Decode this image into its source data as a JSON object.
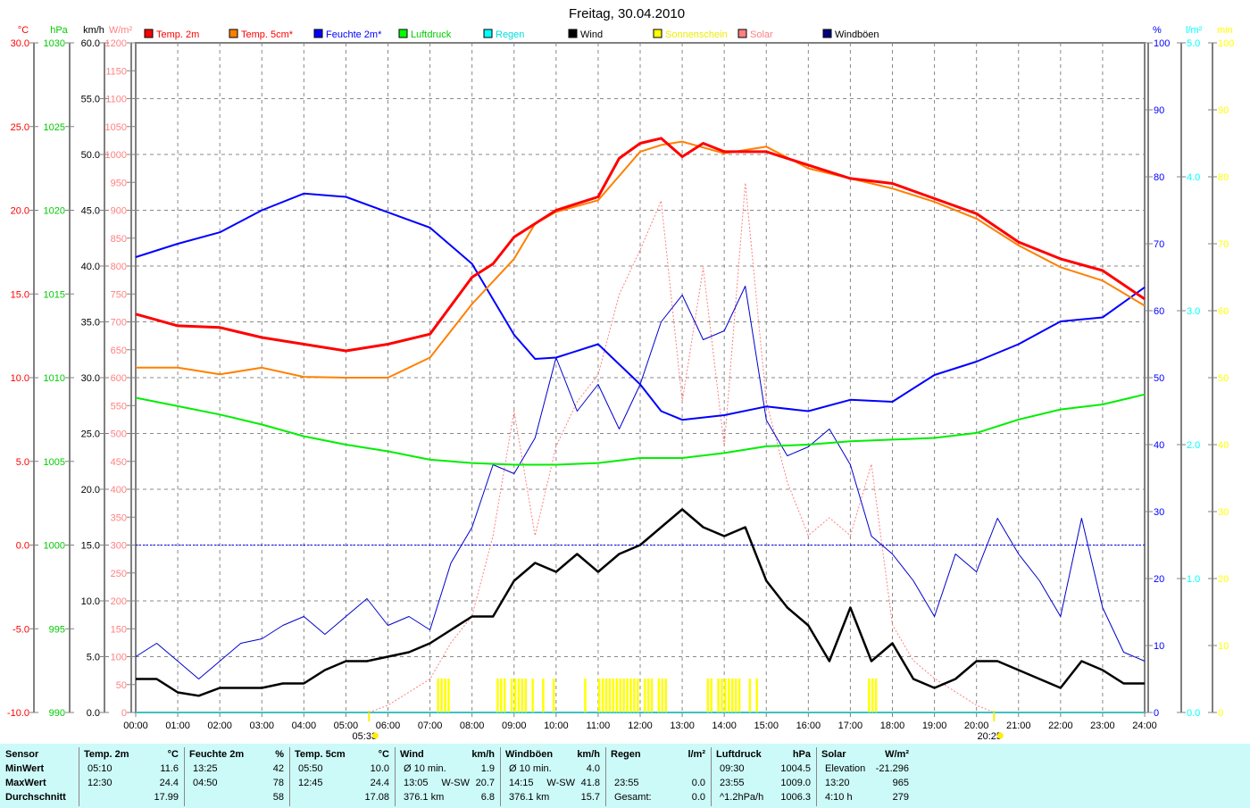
{
  "title": "Freitag, 30.04.2010",
  "colors": {
    "temp2m": "#ff0000",
    "temp5cm": "#ff8000",
    "humidity": "#0000ff",
    "pressure": "#00ee00",
    "rain": "#00ffff",
    "wind": "#000000",
    "sunshine": "#ffff00",
    "solar": "#ff8080",
    "gusts": "#000080"
  },
  "legend": [
    {
      "label": "Temp. 2m",
      "color": "#ff0000",
      "text": "#ff0000"
    },
    {
      "label": "Temp. 5cm*",
      "color": "#ff8000",
      "text": "#ff0000"
    },
    {
      "label": "Feuchte 2m*",
      "color": "#0000ff",
      "text": "#0000ff"
    },
    {
      "label": "Luftdruck",
      "color": "#00ff00",
      "text": "#00cc00"
    },
    {
      "label": "Regen",
      "color": "#00ffff",
      "text": "#00dddd"
    },
    {
      "label": "Wind",
      "color": "#000000",
      "text": "#000000"
    },
    {
      "label": "Sonnenschein",
      "color": "#ffff00",
      "text": "#eeee00"
    },
    {
      "label": "Solar",
      "color": "#ff8080",
      "text": "#ff8080"
    },
    {
      "label": "Windböen",
      "color": "#000080",
      "text": "#000000"
    }
  ],
  "chart_data": {
    "type": "line",
    "title": "Freitag, 30.04.2010",
    "x_unit": "hours",
    "xticks": [
      "00:00",
      "01:00",
      "02:00",
      "03:00",
      "04:00",
      "05:00",
      "06:00",
      "07:00",
      "08:00",
      "09:00",
      "10:00",
      "11:00",
      "12:00",
      "13:00",
      "14:00",
      "15:00",
      "16:00",
      "17:00",
      "18:00",
      "19:00",
      "20:00",
      "21:00",
      "22:00",
      "23:00",
      "24:00"
    ],
    "axes": {
      "celsius": {
        "unit": "°C",
        "range": [
          -10,
          30
        ],
        "ticks": [
          "30.0",
          "25.0",
          "20.0",
          "15.0",
          "10.0",
          "5.0",
          "0.0",
          "-5.0",
          "-10.0"
        ],
        "color": "#ff0000"
      },
      "hpa": {
        "unit": "hPa",
        "range": [
          990,
          1030
        ],
        "ticks": [
          "1030",
          "1025",
          "1020",
          "1015",
          "1010",
          "1005",
          "1000",
          "995",
          "990"
        ],
        "color": "#00cc00"
      },
      "kmh": {
        "unit": "km/h",
        "range": [
          0,
          60
        ],
        "ticks": [
          "60.0",
          "55.0",
          "50.0",
          "45.0",
          "40.0",
          "35.0",
          "30.0",
          "25.0",
          "20.0",
          "15.0",
          "10.0",
          "5.0",
          "0.0"
        ],
        "color": "#000000"
      },
      "wm2": {
        "unit": "W/m²",
        "range": [
          0,
          1200
        ],
        "ticks": [
          "1200",
          "1150",
          "1100",
          "1050",
          "1000",
          "950",
          "900",
          "850",
          "800",
          "750",
          "700",
          "650",
          "600",
          "550",
          "500",
          "450",
          "400",
          "350",
          "300",
          "250",
          "200",
          "150",
          "100",
          "50",
          "0"
        ],
        "color": "#ff8080"
      },
      "percent": {
        "unit": "%",
        "range": [
          0,
          100
        ],
        "ticks": [
          "100",
          "90",
          "80",
          "70",
          "60",
          "50",
          "40",
          "30",
          "20",
          "10",
          "0"
        ],
        "color": "#0000ff"
      },
      "lm2": {
        "unit": "l/m²",
        "range": [
          0,
          5
        ],
        "ticks": [
          "5.0",
          "4.0",
          "3.0",
          "2.0",
          "1.0",
          "0.0"
        ],
        "color": "#00ffff"
      },
      "min": {
        "unit": "min",
        "range": [
          0,
          100
        ],
        "ticks": [
          "100",
          "90",
          "80",
          "70",
          "60",
          "50",
          "40",
          "30",
          "20",
          "10",
          "0"
        ],
        "color": "#ffff00"
      }
    },
    "series": [
      {
        "name": "Temp. 2m",
        "axis": "celsius",
        "x": [
          0,
          1,
          2,
          3,
          4,
          5,
          6,
          7,
          8,
          8.5,
          9,
          10,
          11,
          11.5,
          12,
          12.5,
          13,
          13.5,
          14,
          15,
          16,
          17,
          18,
          19,
          20,
          21,
          22,
          23,
          24
        ],
        "values": [
          13.8,
          13.1,
          13.0,
          12.4,
          12.0,
          11.6,
          12.0,
          12.6,
          16.0,
          16.8,
          18.4,
          20.0,
          20.8,
          23.1,
          24.0,
          24.3,
          23.2,
          24.0,
          23.5,
          23.5,
          22.7,
          21.9,
          21.6,
          20.7,
          19.8,
          18.1,
          17.1,
          16.4,
          14.7
        ]
      },
      {
        "name": "Temp. 5cm*",
        "axis": "celsius",
        "x": [
          0,
          1,
          2,
          3,
          4,
          5,
          6,
          7,
          8,
          9,
          9.5,
          10,
          11,
          12,
          12.5,
          13,
          14,
          15,
          16,
          17,
          18,
          19,
          20,
          21,
          22,
          23,
          24
        ],
        "values": [
          10.6,
          10.6,
          10.2,
          10.6,
          10.05,
          10.0,
          10.0,
          11.2,
          14.4,
          17.1,
          19.2,
          19.9,
          20.6,
          23.5,
          23.9,
          24.1,
          23.4,
          23.8,
          22.5,
          21.9,
          21.3,
          20.5,
          19.5,
          17.9,
          16.6,
          15.8,
          14.3
        ]
      },
      {
        "name": "Feuchte 2m*",
        "axis": "percent",
        "x": [
          0,
          1,
          2,
          3,
          4,
          5,
          6,
          7,
          8,
          8.5,
          9,
          9.5,
          10,
          11,
          12,
          12.5,
          13,
          14,
          15,
          16,
          17,
          18,
          19,
          20,
          21,
          22,
          23,
          24
        ],
        "values": [
          68,
          70,
          71.7,
          75,
          77.5,
          77,
          74.7,
          72.4,
          67,
          61.7,
          56.4,
          52.8,
          53,
          55,
          49,
          45,
          43.7,
          44.4,
          45.7,
          45,
          46.7,
          46.4,
          50.4,
          52.4,
          55,
          58.4,
          59,
          63.5
        ]
      },
      {
        "name": "Luftdruck",
        "axis": "hpa",
        "x": [
          0,
          1,
          2,
          3,
          4,
          5,
          6,
          7,
          8,
          9,
          10,
          11,
          12,
          13,
          14,
          15,
          16,
          17,
          18,
          19,
          20,
          21,
          22,
          23,
          24
        ],
        "values": [
          1008.8,
          1008.3,
          1007.8,
          1007.2,
          1006.5,
          1006.0,
          1005.6,
          1005.1,
          1004.9,
          1004.8,
          1004.8,
          1004.9,
          1005.2,
          1005.2,
          1005.5,
          1005.9,
          1006.0,
          1006.2,
          1006.3,
          1006.4,
          1006.7,
          1007.5,
          1008.1,
          1008.4,
          1009.0
        ]
      },
      {
        "name": "Wind",
        "axis": "kmh",
        "x": [
          0,
          0.5,
          1,
          1.5,
          2,
          2.5,
          3,
          3.5,
          4,
          4.5,
          5,
          5.5,
          6,
          6.5,
          7,
          7.5,
          8,
          8.5,
          9,
          9.5,
          10,
          10.5,
          11,
          11.5,
          12,
          12.5,
          13,
          13.5,
          14,
          14.5,
          15,
          15.5,
          16,
          16.5,
          17,
          17.5,
          18,
          18.5,
          19,
          19.5,
          20,
          20.5,
          21,
          21.5,
          22,
          22.5,
          23,
          23.5,
          24
        ],
        "values": [
          3.0,
          3.0,
          1.8,
          1.5,
          2.2,
          2.2,
          2.2,
          2.6,
          2.6,
          3.8,
          4.6,
          4.6,
          5.0,
          5.4,
          6.2,
          7.4,
          8.6,
          8.6,
          11.8,
          13.4,
          12.6,
          14.2,
          12.6,
          14.2,
          15.0,
          16.6,
          18.2,
          16.6,
          15.8,
          16.6,
          11.8,
          9.4,
          7.8,
          4.6,
          9.4,
          4.6,
          6.2,
          3.0,
          2.2,
          3.0,
          4.6,
          4.6,
          3.8,
          3.0,
          2.2,
          4.6,
          3.8,
          2.6,
          2.6
        ]
      },
      {
        "name": "Windböen",
        "axis": "kmh",
        "x": [
          0,
          0.5,
          1,
          1.5,
          2,
          2.5,
          3,
          3.5,
          4,
          4.5,
          5,
          5.5,
          6,
          6.5,
          7,
          7.5,
          8,
          8.5,
          9,
          9.5,
          10,
          10.5,
          11,
          11.5,
          12,
          12.5,
          13,
          13.5,
          14,
          14.5,
          15,
          15.5,
          16,
          16.5,
          17,
          17.5,
          18,
          18.5,
          19,
          19.5,
          20,
          20.5,
          21,
          21.5,
          22,
          22.5,
          23,
          23.5,
          24
        ],
        "values": [
          5.0,
          6.2,
          4.6,
          3.0,
          4.6,
          6.2,
          6.6,
          7.8,
          8.6,
          7.0,
          8.6,
          10.2,
          7.8,
          8.6,
          7.4,
          13.4,
          16.6,
          22.2,
          21.4,
          24.6,
          31.8,
          27.0,
          29.4,
          25.4,
          29.4,
          35.0,
          37.4,
          33.4,
          34.2,
          38.2,
          26.2,
          23.0,
          23.8,
          25.4,
          22.2,
          15.8,
          14.2,
          11.8,
          8.6,
          14.2,
          12.6,
          17.4,
          14.2,
          11.8,
          8.6,
          17.4,
          9.4,
          5.4,
          4.6
        ]
      },
      {
        "name": "Solar",
        "axis": "wm2",
        "x": [
          5.55,
          6,
          7,
          7.5,
          8,
          8.5,
          9,
          9.5,
          10,
          10.5,
          11,
          11.5,
          12,
          12.5,
          13,
          13.5,
          14,
          14.5,
          15,
          15.5,
          16,
          16.5,
          17,
          17.5,
          18,
          18.5,
          19,
          19.5,
          20,
          20.42
        ],
        "values": [
          0,
          13,
          60,
          125,
          173,
          317,
          540,
          317,
          477,
          557,
          605,
          749,
          829,
          917,
          557,
          797,
          477,
          949,
          557,
          413,
          317,
          349,
          317,
          445,
          157,
          93,
          61,
          37,
          13,
          0
        ]
      },
      {
        "name": "Regen",
        "axis": "lm2",
        "x": [
          0,
          24
        ],
        "values": [
          0,
          0
        ]
      }
    ],
    "sunshine_minutes": [
      "07:10",
      "07:15",
      "07:20",
      "07:25",
      "08:35",
      "08:40",
      "08:45",
      "08:55",
      "09:00",
      "09:05",
      "09:10",
      "09:15",
      "09:25",
      "09:40",
      "09:55",
      "10:40",
      "11:00",
      "11:05",
      "11:10",
      "11:15",
      "11:20",
      "11:25",
      "11:30",
      "11:35",
      "11:40",
      "11:45",
      "11:50",
      "11:55",
      "12:05",
      "12:10",
      "12:15",
      "12:25",
      "12:30",
      "12:35",
      "13:35",
      "13:40",
      "13:50",
      "13:55",
      "14:00",
      "14:05",
      "14:10",
      "14:15",
      "14:20",
      "14:35",
      "14:45",
      "17:25",
      "17:30",
      "17:35"
    ],
    "sunrise": "05:33",
    "sunset": "20:25",
    "reference_line": {
      "axis": "celsius",
      "value": 0
    }
  },
  "stats": {
    "sensor": {
      "h": "Sensor",
      "rows": [
        "MinWert",
        "MaxWert",
        "Durchschnitt"
      ]
    },
    "cols": [
      {
        "h": "Temp. 2m",
        "u": "°C",
        "t": [
          "05:10",
          "12:30",
          ""
        ],
        "v": [
          "11.6",
          "24.4",
          "17.99"
        ]
      },
      {
        "h": "Feuchte 2m",
        "u": "%",
        "t": [
          "13:25",
          "04:50",
          ""
        ],
        "v": [
          "42",
          "78",
          "58"
        ]
      },
      {
        "h": "Temp. 5cm",
        "u": "°C",
        "t": [
          "05:50",
          "12:45",
          ""
        ],
        "v": [
          "10.0",
          "24.4",
          "17.08"
        ]
      },
      {
        "h": "Wind",
        "u": "km/h",
        "t": [
          "Ø 10 min.",
          "13:05",
          "376.1 km"
        ],
        "d": [
          "",
          "W-SW",
          ""
        ],
        "v": [
          "1.9",
          "20.7",
          "6.8"
        ]
      },
      {
        "h": "Windböen",
        "u": "km/h",
        "t": [
          "Ø 10 min.",
          "14:15",
          "376.1 km"
        ],
        "d": [
          "",
          "W-SW",
          ""
        ],
        "v": [
          "4.0",
          "41.8",
          "15.7"
        ]
      },
      {
        "h": "Regen",
        "u": "l/m²",
        "t": [
          "",
          "23:55",
          "Gesamt:"
        ],
        "v": [
          "",
          "0.0",
          "0.0"
        ]
      },
      {
        "h": "Luftdruck",
        "u": "hPa",
        "t": [
          "09:30",
          "23:55",
          "^1.2hPa/h"
        ],
        "v": [
          "1004.5",
          "1009.0",
          "1006.3"
        ]
      },
      {
        "h": "Solar",
        "u": "W/m²",
        "t": [
          "Elevation",
          "13:20",
          "4:10 h"
        ],
        "v": [
          "-21.296",
          "965",
          "279"
        ]
      }
    ]
  }
}
